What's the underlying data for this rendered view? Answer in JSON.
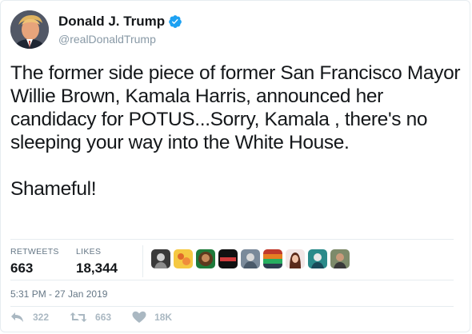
{
  "user": {
    "display_name": "Donald J. Trump",
    "handle": "@realDonaldTrump",
    "verified_icon": "verified-badge-icon"
  },
  "tweet": {
    "paragraphs": [
      "The former side piece of former San Francisco Mayor Willie Brown, Kamala Harris, announced her candidacy for POTUS...Sorry, Kamala ,  there's no sleeping your way into the White House.",
      "Shameful!"
    ]
  },
  "stats": {
    "retweets_label": "RETWEETS",
    "retweets_value": "663",
    "likes_label": "LIKES",
    "likes_value": "18,344"
  },
  "timestamp": "5:31 PM - 27 Jan 2019",
  "actions": {
    "reply_icon": "reply-icon",
    "reply_count": "322",
    "retweet_icon": "retweet-icon",
    "retweet_count": "663",
    "like_icon": "heart-icon",
    "like_count": "18K"
  },
  "colors": {
    "verified": "#1da1f2",
    "muted": "#657786",
    "action_gray": "#aab8c2"
  }
}
